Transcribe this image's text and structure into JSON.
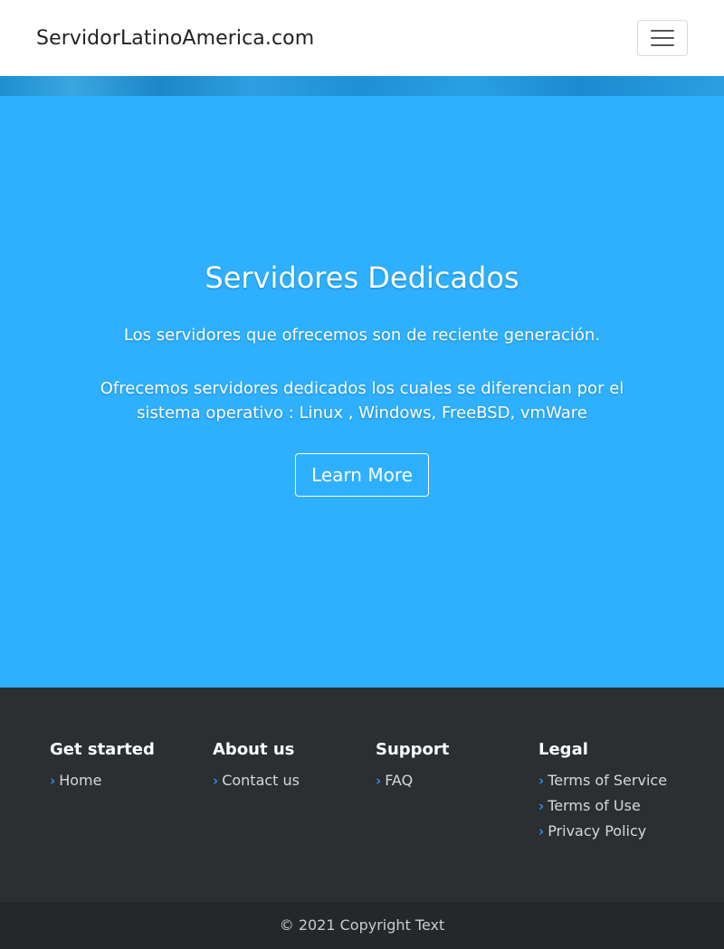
{
  "navbar": {
    "brand": "ServidorLatinoAmerica.com",
    "toggle_icon": "hamburger-menu-icon"
  },
  "hero": {
    "title": "Servidores Dedicados",
    "paragraph1": "Los servidores que ofrecemos son de reciente generación.",
    "paragraph2": "Ofrecemos servidores dedicados los cuales se diferencian por el sistema operativo : Linux , Windows, FreeBSD, vmWare",
    "button_label": "Learn More",
    "background_color": "#2eb0ff"
  },
  "footer": {
    "columns": [
      {
        "heading": "Get started",
        "links": [
          "Home"
        ]
      },
      {
        "heading": "About us",
        "links": [
          "Contact us"
        ]
      },
      {
        "heading": "Support",
        "links": [
          "FAQ"
        ]
      },
      {
        "heading": "Legal",
        "links": [
          "Terms of Service",
          "Terms of Use",
          "Privacy Policy"
        ]
      }
    ],
    "link_icon": "chevron-right-icon",
    "copyright": "© 2021 Copyright Text"
  }
}
